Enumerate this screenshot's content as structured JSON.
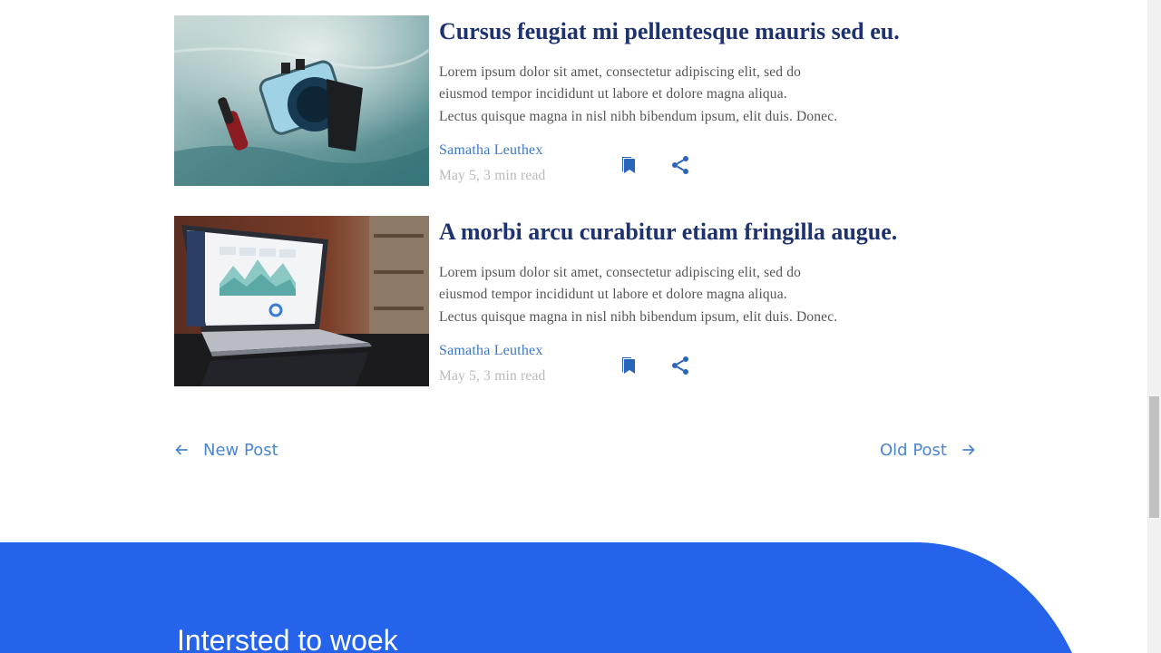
{
  "posts": [
    {
      "title": "Cursus feugiat mi pellentesque mauris sed eu.",
      "excerpt_lines": [
        "Lorem ipsum dolor sit amet, consectetur adipiscing elit, sed do",
        "eiusmod tempor incididunt ut labore et dolore magna aliqua.",
        "Lectus quisque magna in nisl nibh bibendum ipsum, elit duis. Donec."
      ],
      "author": "Samatha Leuthex",
      "meta": "May 5, 3 min read",
      "image": "underwater-camera-housing-on-sand"
    },
    {
      "title": "A morbi arcu curabitur etiam fringilla augue.",
      "excerpt_lines": [
        "Lorem ipsum dolor sit amet, consectetur adipiscing elit, sed do",
        "eiusmod tempor incididunt ut labore et dolore magna aliqua.",
        "Lectus quisque magna in nisl nibh bibendum ipsum, elit duis. Donec."
      ],
      "author": "Samatha Leuthex",
      "meta": "May 5, 3 min read",
      "image": "laptop-with-analytics-dashboard"
    }
  ],
  "icons": {
    "bookmark": "bookmark-icon",
    "share": "share-icon",
    "prev_arrow": "arrow-left-icon",
    "next_arrow": "arrow-right-icon"
  },
  "pagination": {
    "prev_label": "New Post",
    "next_label": "Old Post"
  },
  "footer": {
    "heading": "Intersted to woek"
  },
  "colors": {
    "title": "#1e3270",
    "author_link": "#3e77c4",
    "meta": "#b9b9b9",
    "icon": "#2a66b8",
    "pager": "#4a86d0",
    "footer_bg": "#2563eb"
  }
}
